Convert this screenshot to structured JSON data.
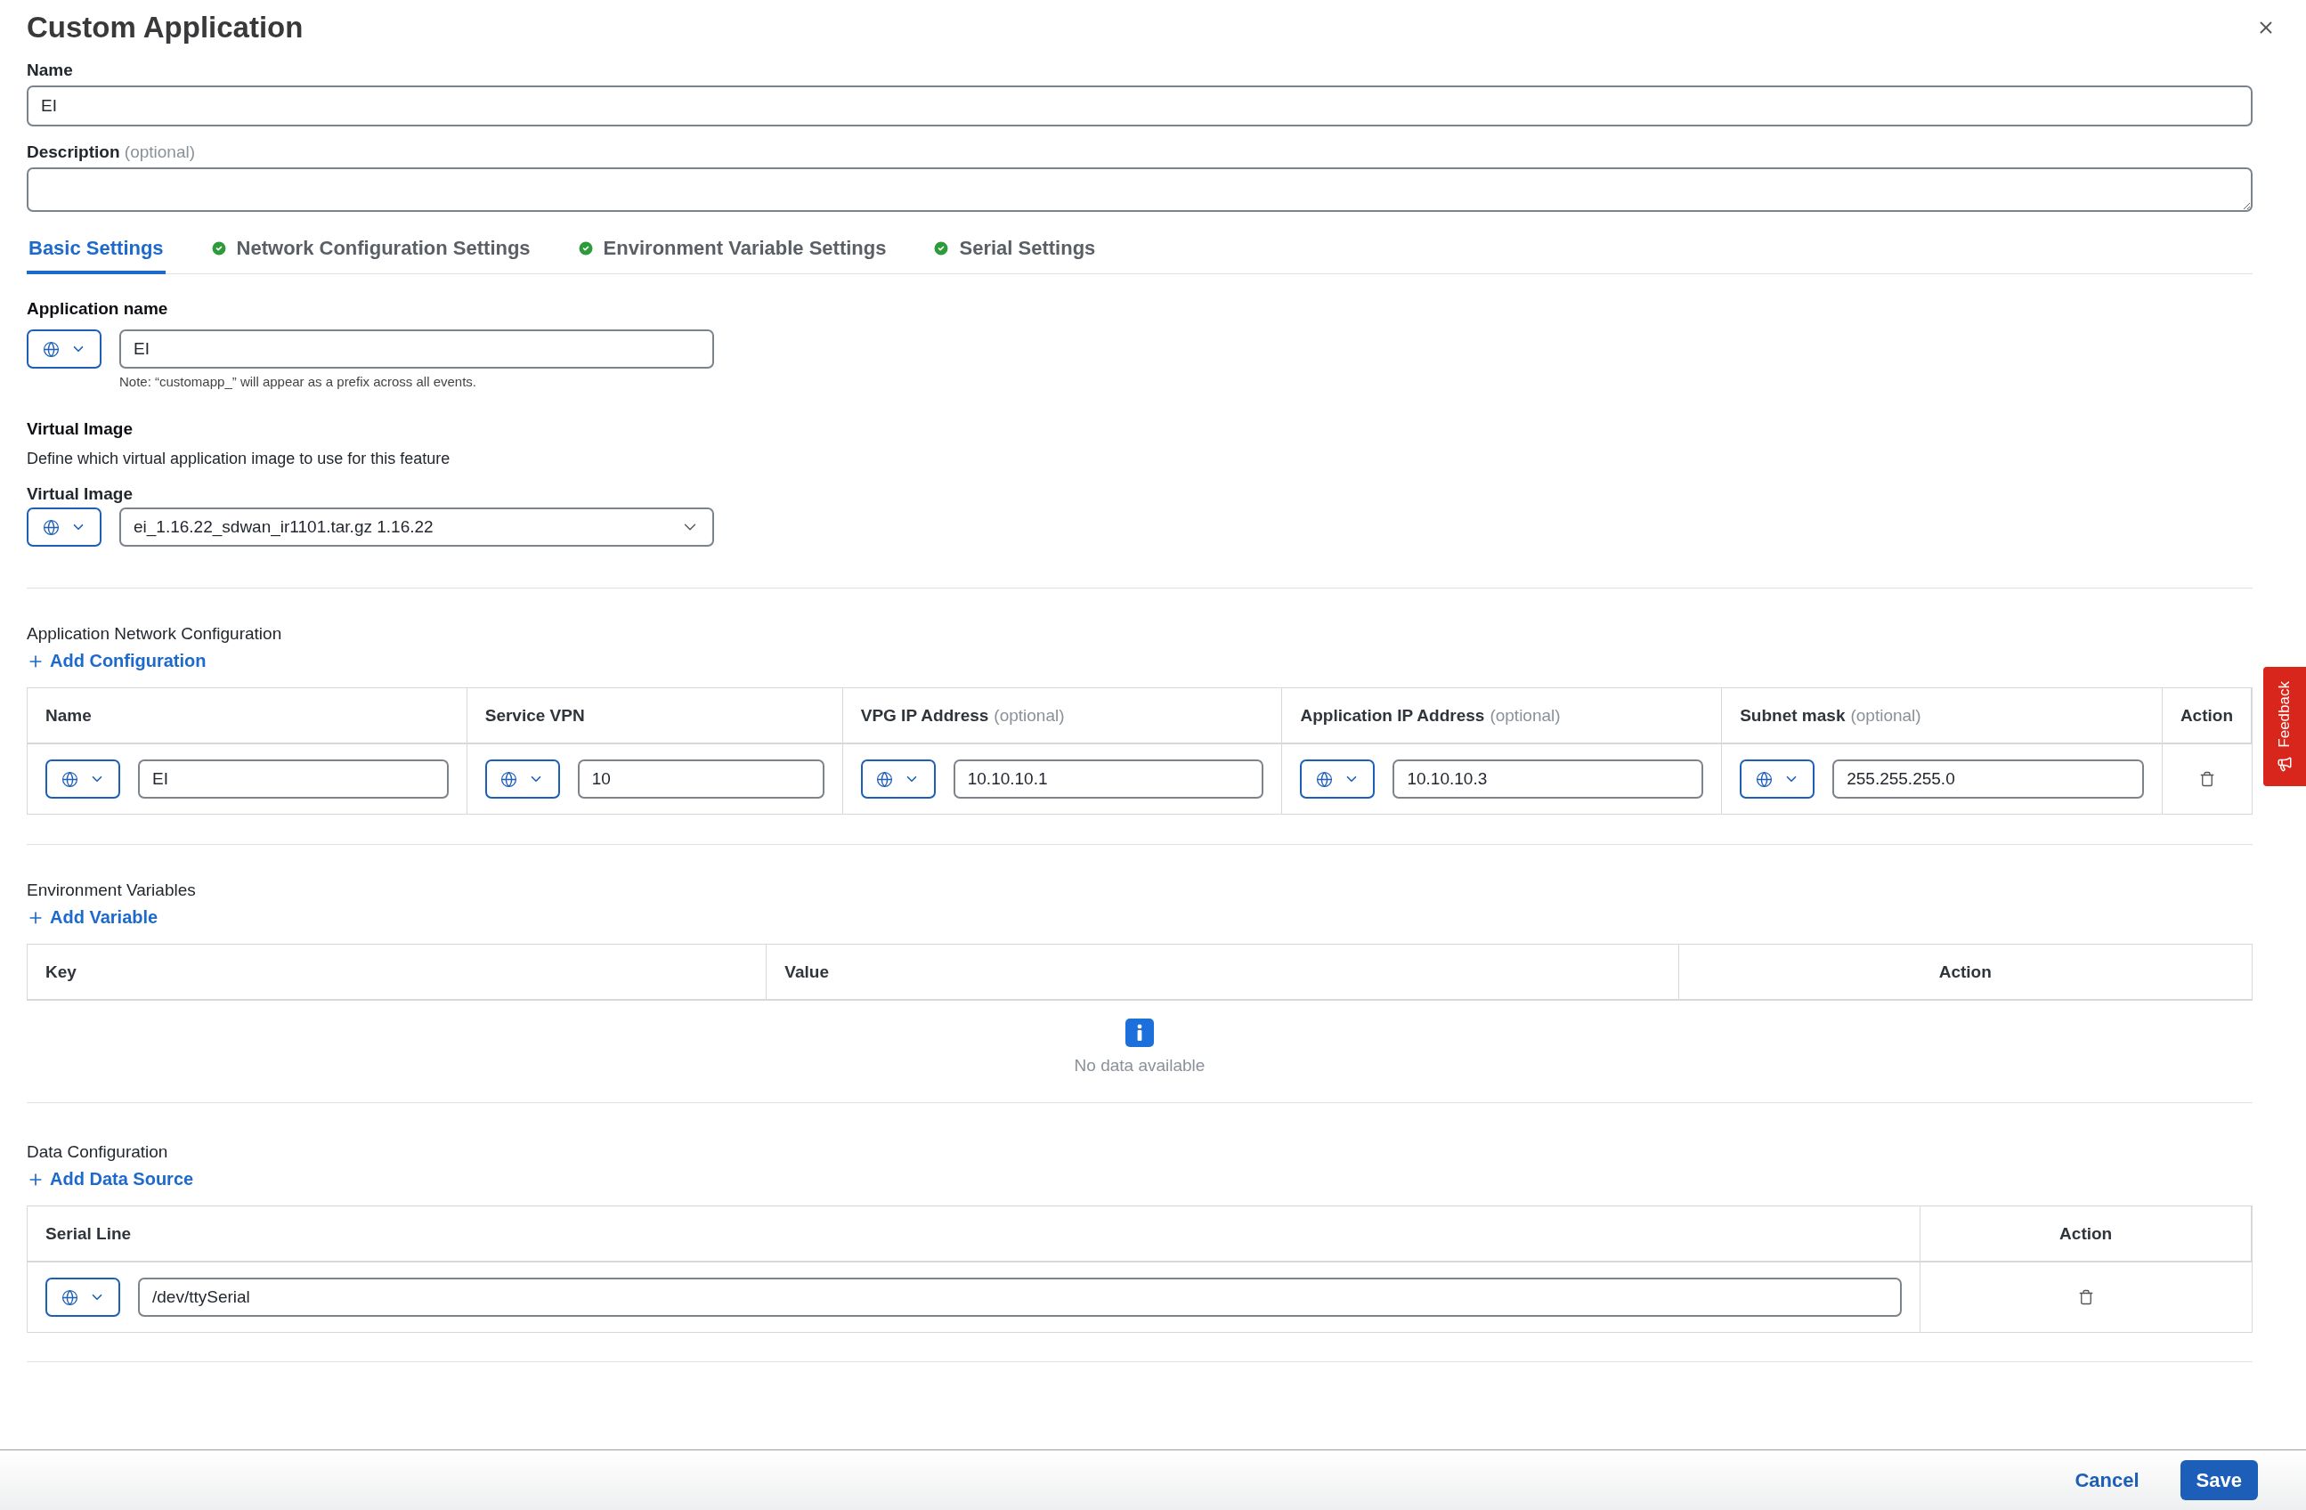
{
  "dialog": {
    "title": "Custom Application"
  },
  "name_field": {
    "label": "Name",
    "value": "EI"
  },
  "description_field": {
    "label": "Description",
    "hint": "(optional)"
  },
  "tabs": [
    {
      "label": "Basic Settings",
      "selected": true,
      "completed": false
    },
    {
      "label": "Network Configuration Settings",
      "selected": false,
      "completed": true
    },
    {
      "label": "Environment Variable Settings",
      "selected": false,
      "completed": true
    },
    {
      "label": "Serial Settings",
      "selected": false,
      "completed": true
    }
  ],
  "application_name": {
    "heading": "Application name",
    "value": "EI",
    "note": "Note: “customapp_” will appear as a prefix across all events."
  },
  "virtual_image": {
    "heading": "Virtual Image",
    "description": "Define which virtual application image to use for this feature",
    "label": "Virtual Image",
    "value": "ei_1.16.22_sdwan_ir1101.tar.gz 1.16.22"
  },
  "network_config": {
    "heading": "Application Network Configuration",
    "add_label": "Add Configuration",
    "columns": [
      {
        "label": "Name"
      },
      {
        "label": "Service VPN"
      },
      {
        "label": "VPG IP Address",
        "hint": "(optional)"
      },
      {
        "label": "Application IP Address",
        "hint": "(optional)"
      },
      {
        "label": "Subnet mask",
        "hint": "(optional)"
      },
      {
        "label": "Action"
      }
    ],
    "rows": [
      {
        "values": [
          "EI",
          "10",
          "10.10.10.1",
          "10.10.10.3",
          "255.255.255.0"
        ]
      }
    ]
  },
  "environment_variables": {
    "heading": "Environment Variables",
    "add_label": "Add Variable",
    "columns": [
      {
        "label": "Key"
      },
      {
        "label": "Value"
      },
      {
        "label": "Action"
      }
    ],
    "empty_message": "No data available"
  },
  "data_config": {
    "heading": "Data Configuration",
    "add_label": "Add Data Source",
    "columns": [
      {
        "label": "Serial Line"
      },
      {
        "label": "Action"
      }
    ],
    "rows": [
      {
        "values": [
          "/dev/ttySerial"
        ]
      }
    ]
  },
  "feedback_tab": {
    "label": "Feedback"
  },
  "footer": {
    "cancel": "Cancel",
    "save": "Save"
  }
}
